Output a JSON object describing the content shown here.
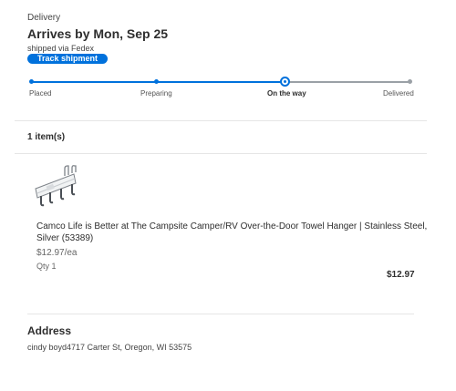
{
  "delivery": {
    "label": "Delivery",
    "arrival": "Arrives by Mon, Sep 25",
    "shipped_via": "shipped via Fedex",
    "track_button": "Track shipment",
    "progress": {
      "stages": [
        "Placed",
        "Preparing",
        "On the way",
        "Delivered"
      ],
      "current_stage_index": 2
    },
    "colors": {
      "accent": "#0071dc",
      "inactive": "#9aa0a6"
    }
  },
  "items": {
    "count_label": "1 item(s)",
    "list": [
      {
        "title": "Camco Life is Better at The Campsite Camper/RV Over-the-Door Towel Hanger | Stainless Steel, Silver (53389)",
        "unit_price": "$12.97/ea",
        "qty": "Qty 1",
        "total": "$12.97",
        "image_icon": "towel-hanger-image"
      }
    ]
  },
  "address": {
    "title": "Address",
    "text": "cindy boyd4717 Carter St, Oregon, WI 53575"
  }
}
